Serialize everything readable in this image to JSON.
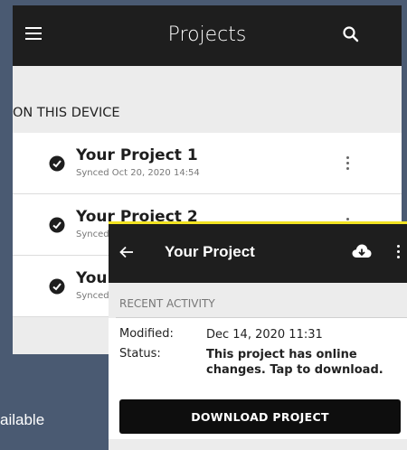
{
  "header": {
    "title": "Projects"
  },
  "section": {
    "label": "ON THIS DEVICE"
  },
  "projects": [
    {
      "name": "Your Project 1",
      "sync": "Synced Oct 20, 2020 14:54"
    },
    {
      "name": "Your Project 2",
      "sync": "Synced"
    },
    {
      "name": "You",
      "sync": "Synced"
    }
  ],
  "detail": {
    "title": "Your Project",
    "recent_label": "RECENT ACTIVITY",
    "modified_label": "Modified:",
    "modified_value": "Dec 14, 2020 11:31",
    "status_label": "Status:",
    "status_value": "This project has online changes. Tap to download.",
    "download_label": "DOWNLOAD PROJECT"
  },
  "caption": {
    "text": "ailable"
  },
  "colors": {
    "appbar": "#1e1e1e",
    "background": "#4a5a72",
    "accent": "#f2e322"
  }
}
